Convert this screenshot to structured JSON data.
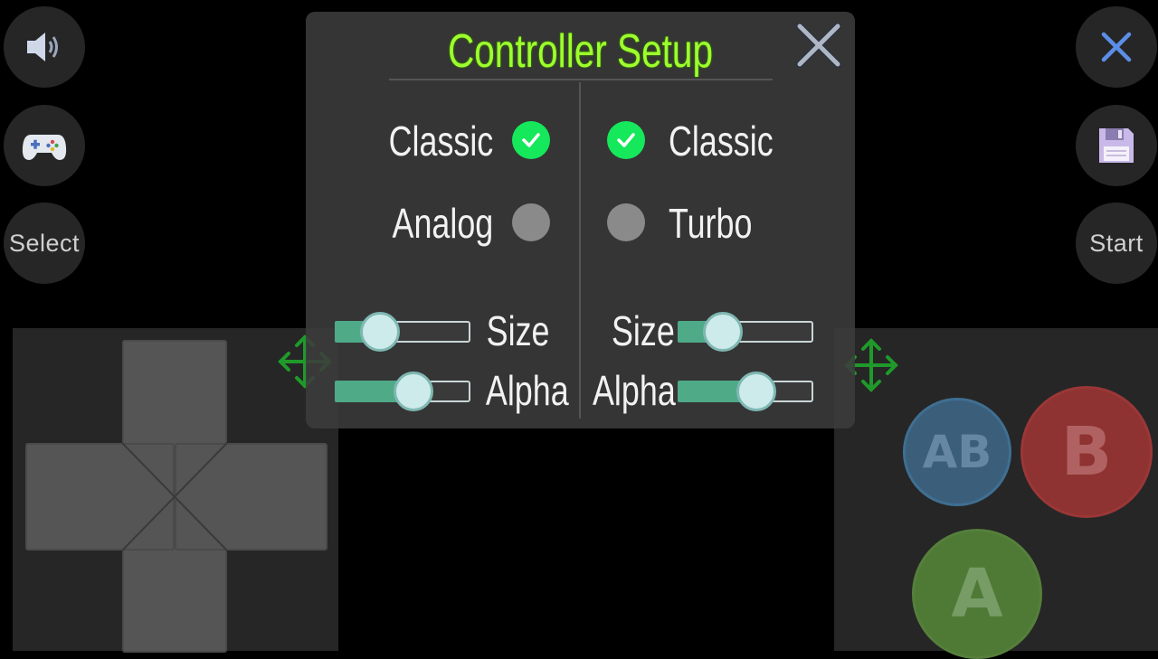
{
  "sidebar_left": {
    "sound_icon": "speaker-icon",
    "gamepad_icon": "gamepad-icon",
    "select_label": "Select"
  },
  "sidebar_right": {
    "close_icon": "close-icon",
    "save_icon": "floppy-disk-icon",
    "start_label": "Start"
  },
  "dialog": {
    "title": "Controller Setup",
    "left": {
      "options": [
        {
          "label": "Classic",
          "selected": true
        },
        {
          "label": "Analog",
          "selected": false
        }
      ],
      "size_label": "Size",
      "alpha_label": "Alpha",
      "size_value": 0.33,
      "alpha_value": 0.58
    },
    "right": {
      "options": [
        {
          "label": "Classic",
          "selected": true
        },
        {
          "label": "Turbo",
          "selected": false
        }
      ],
      "size_label": "Size",
      "alpha_label": "Alpha",
      "size_value": 0.33,
      "alpha_value": 0.58
    }
  },
  "buttons": {
    "ab_label": "AB",
    "b_label": "B",
    "a_label": "A"
  },
  "colors": {
    "accent_green": "#9dff2e",
    "radio_on": "#15e85a",
    "move_icon": "#1f9a2a",
    "button_ab": "#3b5e7a",
    "button_b": "#8e3232",
    "button_a": "#4e7a36"
  }
}
